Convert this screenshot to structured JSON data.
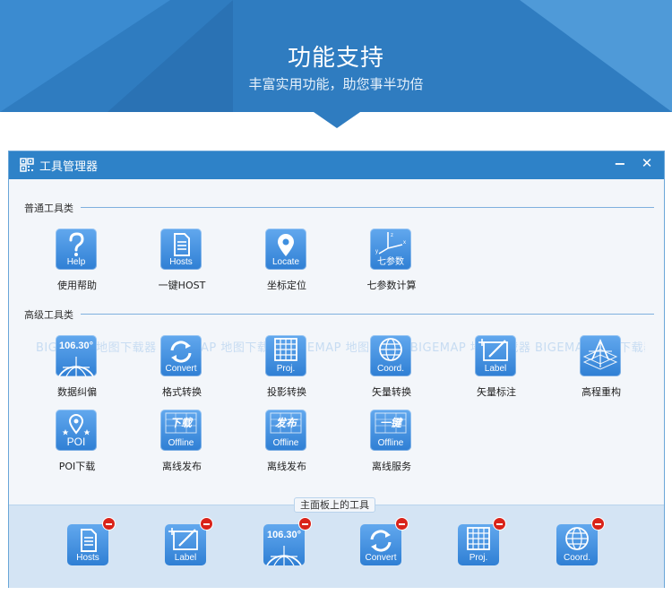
{
  "banner": {
    "title": "功能支持",
    "subtitle": "丰富实用功能，助您事半功倍"
  },
  "window": {
    "title": "工具管理器",
    "minimize_glyph": "−",
    "close_glyph": "✕"
  },
  "sections": {
    "common": "普通工具类",
    "advanced": "高级工具类"
  },
  "watermark": "BIGEMAP 地图下载器 BIGEMAP 地图下载器 BIGEMAP 地图下载器 BIGEMAP 地图下载器 BIGEMAP 地图下载器",
  "common_tools": [
    {
      "name": "使用帮助",
      "caption": "Help",
      "icon": "question-icon"
    },
    {
      "name": "一键HOST",
      "caption": "Hosts",
      "icon": "document-icon"
    },
    {
      "name": "坐标定位",
      "caption": "Locate",
      "icon": "location-pin-icon"
    },
    {
      "name": "七参数计算",
      "caption": "七参数",
      "icon": "axes-icon"
    }
  ],
  "advanced_tools": [
    {
      "name": "数据纠偏",
      "caption": "106.30°",
      "icon": "globe-grid-icon"
    },
    {
      "name": "格式转换",
      "caption": "Convert",
      "icon": "refresh-icon"
    },
    {
      "name": "投影转换",
      "caption": "Proj.",
      "icon": "grid-icon"
    },
    {
      "name": "矢量转换",
      "caption": "Coord.",
      "icon": "globe-icon"
    },
    {
      "name": "矢量标注",
      "caption": "Label",
      "icon": "label-pen-icon"
    },
    {
      "name": "高程重构",
      "caption": "",
      "icon": "terrain-icon"
    },
    {
      "name": "POI下载",
      "caption": "POI",
      "icon": "poi-pin-icon"
    },
    {
      "name": "离线发布",
      "caption": "Offline",
      "icon": "offline-download-icon",
      "badge": "下载"
    },
    {
      "name": "离线发布",
      "caption": "Offline",
      "icon": "offline-release-icon",
      "badge": "发布"
    },
    {
      "name": "离线服务",
      "caption": "Offline",
      "icon": "offline-service-icon",
      "badge": "一键"
    }
  ],
  "main_panel": {
    "label": "主面板上的工具",
    "tools": [
      {
        "caption": "Hosts",
        "icon": "document-icon"
      },
      {
        "caption": "Label",
        "icon": "label-pen-icon"
      },
      {
        "caption": "106.30°",
        "icon": "globe-grid-icon"
      },
      {
        "caption": "Convert",
        "icon": "refresh-icon"
      },
      {
        "caption": "Proj.",
        "icon": "grid-icon"
      },
      {
        "caption": "Coord.",
        "icon": "globe-icon"
      }
    ]
  },
  "colors": {
    "banner": "#2f7cc0",
    "titlebar": "#2e82c8",
    "tile_top": "#62a8ee",
    "tile_bottom": "#2f7fd4",
    "remove_badge": "#d9231a"
  }
}
